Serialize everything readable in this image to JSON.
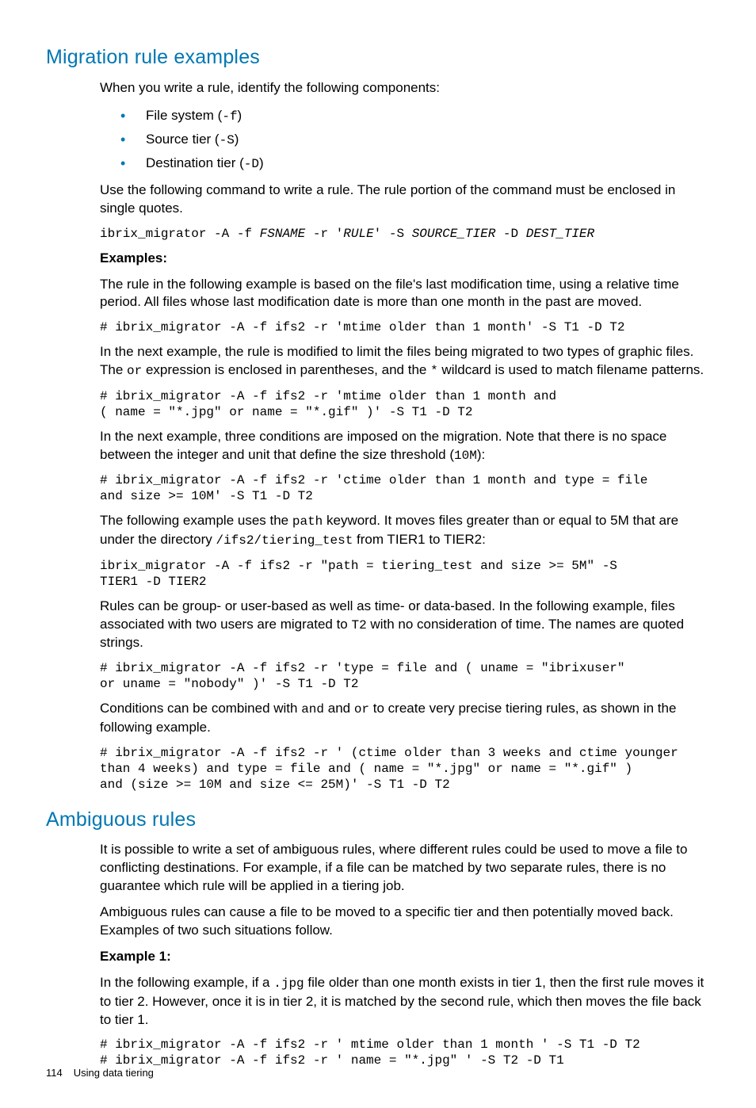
{
  "section1": {
    "title": "Migration rule examples",
    "intro": "When you write a rule, identify the following components:",
    "bullets": [
      {
        "pre": "File system (",
        "code": "-f",
        "post": ")"
      },
      {
        "pre": "Source tier (",
        "code": "-S",
        "post": ")"
      },
      {
        "pre": "Destination tier (",
        "code": "-D",
        "post": ")"
      }
    ],
    "usecmd": "Use the following command to write a rule. The rule portion of the command must be enclosed in single quotes.",
    "cmd1_a": "ibrix_migrator -A -f ",
    "cmd1_b": "FSNAME",
    "cmd1_c": " -r '",
    "cmd1_d": "RULE",
    "cmd1_e": "' -S ",
    "cmd1_f": "SOURCE_TIER",
    "cmd1_g": " -D ",
    "cmd1_h": "DEST_TIER",
    "examples_label": "Examples:",
    "p_ex1": "The rule in the following example is based on the file's last modification time, using a relative time period. All files whose last modification date is more than one month in the past are moved.",
    "code_ex1": "# ibrix_migrator -A -f ifs2 -r 'mtime older than 1 month' -S T1 -D T2",
    "p_ex2a": "In the next example, the rule is modified to limit the files being migrated to two types of graphic files. The ",
    "p_ex2_code1": "or",
    "p_ex2b": " expression is enclosed in parentheses, and the ",
    "p_ex2_code2": "*",
    "p_ex2c": " wildcard is used to match filename patterns.",
    "code_ex2": "# ibrix_migrator -A -f ifs2 -r 'mtime older than 1 month and\n( name = \"*.jpg\" or name = \"*.gif\" )' -S T1 -D T2",
    "p_ex3a": "In the next example, three conditions are imposed on the migration. Note that there is no space between the integer and unit that define the size threshold (",
    "p_ex3_code": "10M",
    "p_ex3b": "):",
    "code_ex3": "# ibrix_migrator -A -f ifs2 -r 'ctime older than 1 month and type = file\nand size >= 10M' -S T1 -D T2",
    "p_ex4a": "The following example uses the ",
    "p_ex4_code1": "path",
    "p_ex4b": " keyword. It moves files greater than or equal to 5M that are under the directory  ",
    "p_ex4_code2": "/ifs2/tiering_test",
    "p_ex4c": " from TIER1 to TIER2:",
    "code_ex4": "ibrix_migrator -A -f ifs2 -r \"path = tiering_test and size >= 5M\" -S\nTIER1 -D TIER2",
    "p_ex5a": "Rules can be group- or user-based as well as time- or data-based. In the following example, files associated with two users are migrated to ",
    "p_ex5_code": "T2",
    "p_ex5b": " with no consideration of time. The names are quoted strings.",
    "code_ex5": "# ibrix_migrator -A -f ifs2 -r 'type = file and ( uname = \"ibrixuser\"\nor uname = \"nobody\" )' -S T1 -D T2",
    "p_ex6a": "Conditions can be combined with ",
    "p_ex6_code1": "and",
    "p_ex6b": " and ",
    "p_ex6_code2": "or",
    "p_ex6c": " to create very precise tiering rules, as shown in the following example.",
    "code_ex6": "# ibrix_migrator -A -f ifs2 -r ' (ctime older than 3 weeks and ctime younger\nthan 4 weeks) and type = file and ( name = \"*.jpg\" or name = \"*.gif\" )\nand (size >= 10M and size <= 25M)' -S T1 -D T2"
  },
  "section2": {
    "title": "Ambiguous rules",
    "p1": "It is possible to write a set of ambiguous rules, where different rules could be used to move a file to conflicting destinations. For example, if a file can be matched by two separate rules, there is no guarantee which rule will be applied in a tiering job.",
    "p2": "Ambiguous rules can cause a file to be moved to a specific tier and then potentially moved back. Examples of two such situations follow.",
    "example1_label": "Example 1:",
    "p3a": "In the following example, if a ",
    "p3_code": ".jpg",
    "p3b": " file older than one month exists in tier 1, then the first rule moves it to tier 2. However, once it is in tier 2, it is matched by the second rule, which then moves the file back to tier 1.",
    "code1": "# ibrix_migrator -A -f ifs2 -r ' mtime older than 1 month ' -S T1 -D T2\n# ibrix_migrator -A -f ifs2 -r ' name = \"*.jpg\" ' -S T2 -D T1"
  },
  "footer": {
    "page": "114",
    "title": "Using data tiering"
  }
}
